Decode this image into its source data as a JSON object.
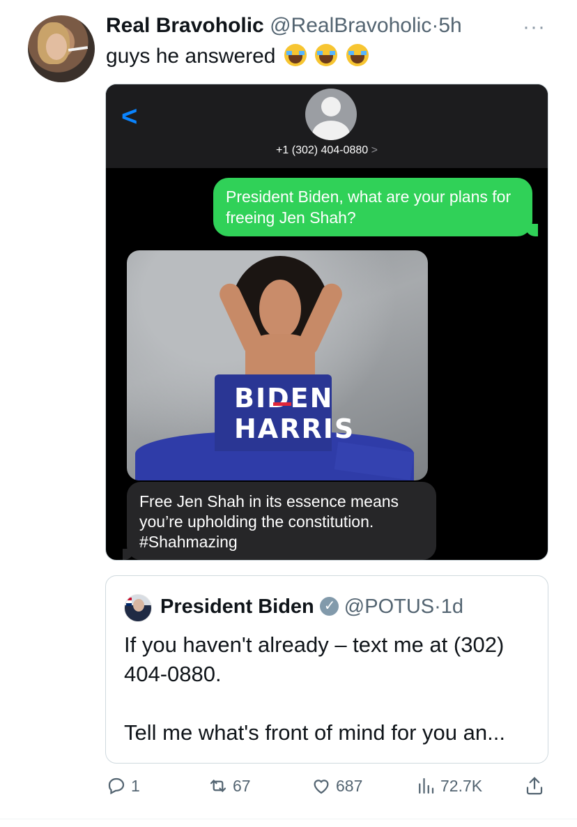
{
  "tweet": {
    "author_name": "Real Bravoholic",
    "handle": "@RealBravoholic",
    "separator": "·",
    "time": "5h",
    "text": "guys he answered",
    "more_icon": "···",
    "emoji_count": 3
  },
  "imessage": {
    "back_icon": "<",
    "contact_number": "+1 (302) 404-0880",
    "contact_chevron": ">",
    "outgoing_message": "President Biden, what are your plans for freeing Jen Shah?",
    "photo_text": "BIDEN HARRIS",
    "incoming_message": "Free Jen Shah in its essence means you’re upholding the constitution. #Shahmazing",
    "colors": {
      "outgoing_bubble": "#30d158",
      "incoming_bubble": "#262628",
      "accent": "#0a84ff"
    }
  },
  "quoted_tweet": {
    "author_name": "President Biden",
    "handle": "@POTUS",
    "separator": "·",
    "time": "1d",
    "text": "If you haven't already – text me at (302) 404-0880.\n\nTell me what's front of mind for you an..."
  },
  "actions": {
    "replies": "1",
    "retweets": "67",
    "likes": "687",
    "views": "72.7K"
  }
}
